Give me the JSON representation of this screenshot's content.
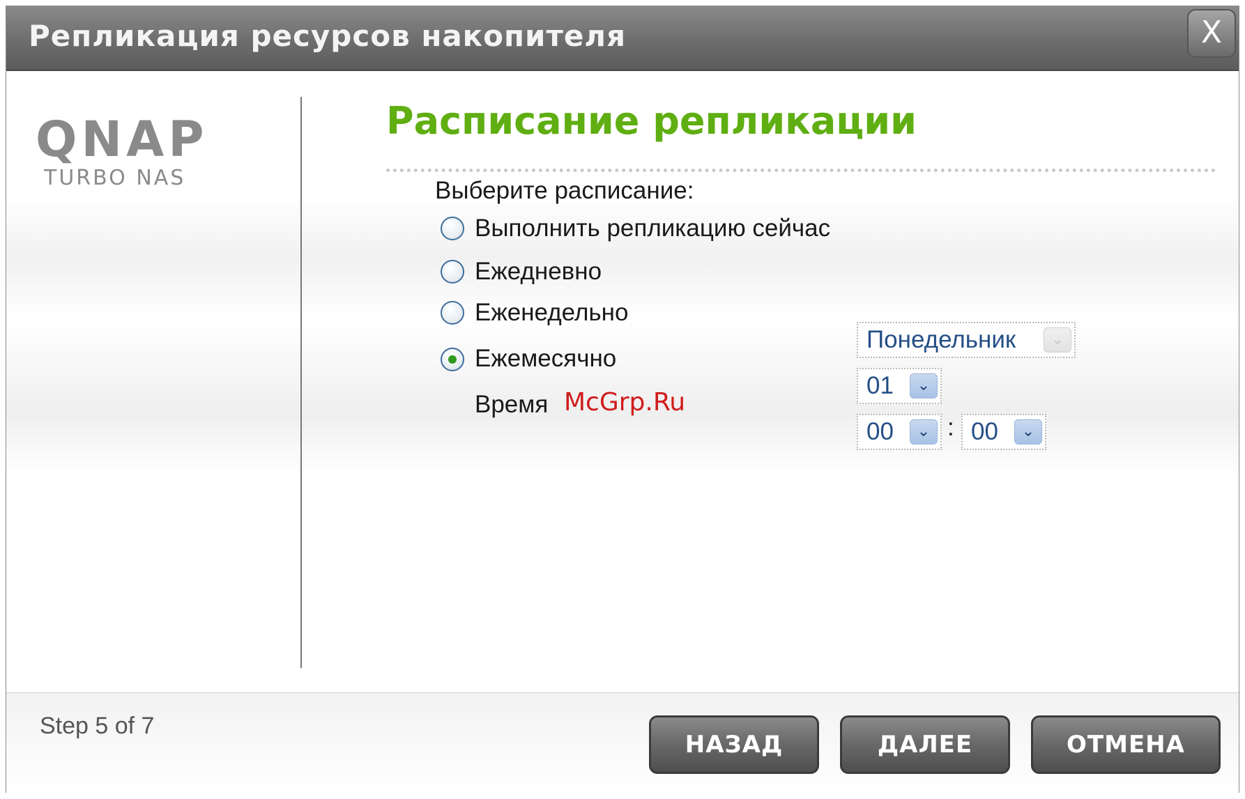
{
  "window": {
    "title": "Репликация ресурсов накопителя",
    "close_label": "X"
  },
  "logo": {
    "main": "QNAP",
    "sub": "TURBO NAS"
  },
  "page": {
    "heading": "Расписание репликации",
    "prompt": "Выберите расписание:"
  },
  "schedule": {
    "options": [
      {
        "label": "Выполнить репликацию сейчас",
        "selected": false
      },
      {
        "label": "Ежедневно",
        "selected": false
      },
      {
        "label": "Еженедельно",
        "selected": false
      },
      {
        "label": "Ежемесячно",
        "selected": true
      }
    ],
    "weekday_select": {
      "value": "Понедельник",
      "enabled": false
    },
    "day_select": {
      "value": "01"
    },
    "time_label": "Время",
    "hour_select": {
      "value": "00"
    },
    "minute_select": {
      "value": "00"
    },
    "time_separator": ":"
  },
  "watermark": "McGrp.Ru",
  "footer": {
    "step_text": "Step 5 of 7",
    "back_label": "НАЗАД",
    "next_label": "ДАЛЕЕ",
    "cancel_label": "ОТМЕНА"
  },
  "icons": {
    "close": "close-icon",
    "dropdown": "chevron-down-icon"
  },
  "colors": {
    "heading": "#5fae12",
    "radio_selected": "#2f9a1f",
    "select_text": "#244f86",
    "watermark": "#d01c1c"
  }
}
